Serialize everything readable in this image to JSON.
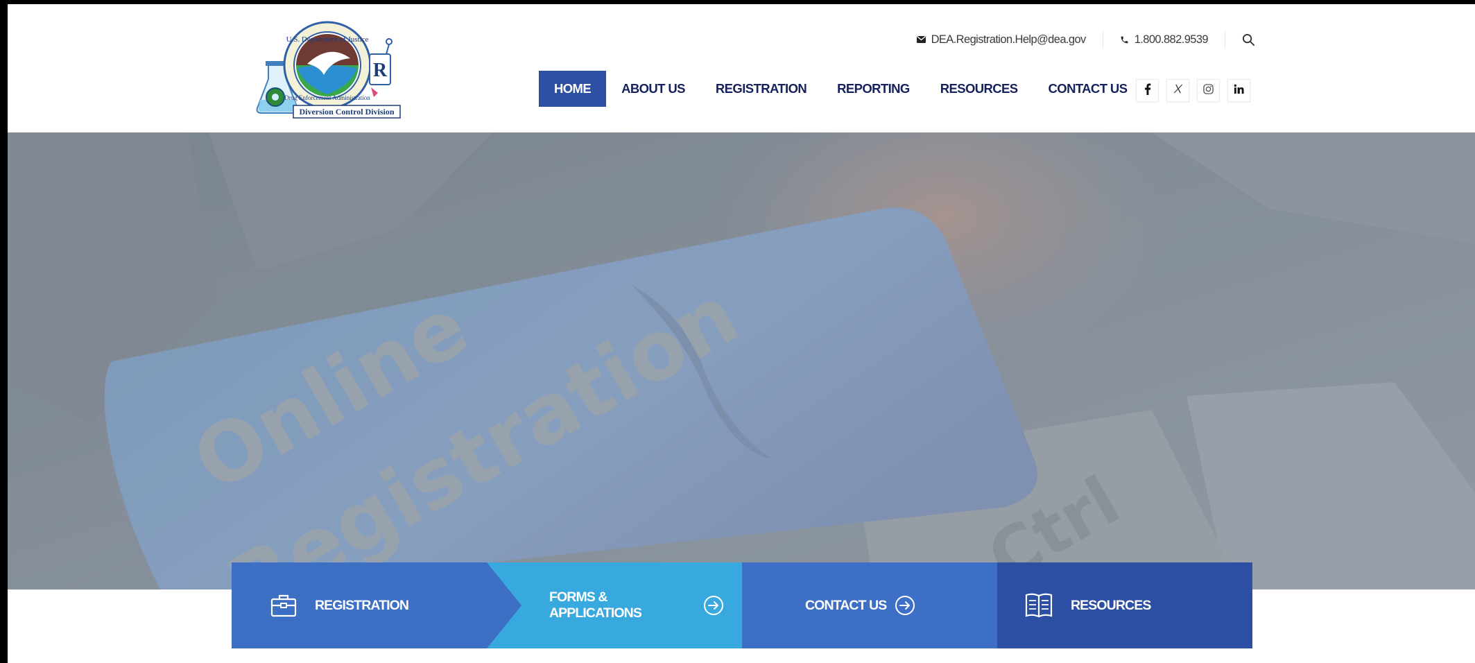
{
  "header": {
    "logo": {
      "seal_text_top": "U.S. Department of Justice",
      "seal_text_bottom": "Drug Enforcement Administration",
      "banner": "Diversion Control Division",
      "rx_letter": "R"
    },
    "contact": {
      "email": "DEA.Registration.Help@dea.gov",
      "phone": "1.800.882.9539"
    },
    "nav": [
      {
        "label": "HOME",
        "active": true
      },
      {
        "label": "ABOUT US",
        "active": false
      },
      {
        "label": "REGISTRATION",
        "active": false
      },
      {
        "label": "REPORTING",
        "active": false
      },
      {
        "label": "RESOURCES",
        "active": false
      },
      {
        "label": "CONTACT US",
        "active": false
      }
    ],
    "social": [
      "facebook-icon",
      "x-twitter-icon",
      "instagram-icon",
      "linkedin-icon"
    ]
  },
  "hero": {
    "image_text_line1": "Online",
    "image_text_line2": "Registration",
    "image_text_key": "Ctrl"
  },
  "features": [
    {
      "label": "REGISTRATION",
      "icon": "briefcase-icon",
      "color": "#3d6fc5"
    },
    {
      "label": "FORMS & APPLICATIONS",
      "icon": "arrow-circle-icon",
      "color": "#38a9de"
    },
    {
      "label": "CONTACT US",
      "icon": "arrow-circle-icon",
      "color": "#3e6fc7"
    },
    {
      "label": "RESOURCES",
      "icon": "book-icon",
      "color": "#2c4fa3"
    }
  ],
  "colors": {
    "primary": "#2c4fa3",
    "nav_text": "#15215c",
    "accent_light": "#38a9de"
  }
}
